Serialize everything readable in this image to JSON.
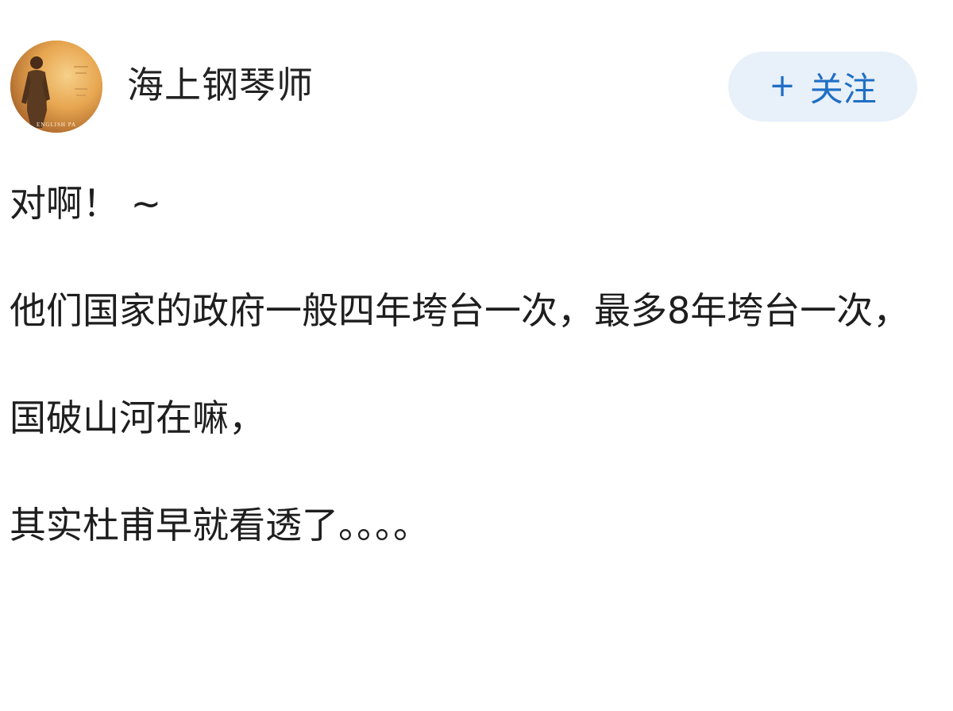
{
  "post": {
    "author": {
      "name": "海上钢琴师",
      "avatar_caption": "ENGLISH PA"
    },
    "follow_button": {
      "icon": "plus-icon",
      "plus_text": "+",
      "label": "关注"
    },
    "paragraphs": [
      "对啊！ ~",
      "他们国家的政府一般四年垮台一次，最多8年垮台一次，",
      "国破山河在嘛，",
      "其实杜甫早就看透了。。。。"
    ]
  },
  "colors": {
    "follow_bg": "#e8f0fa",
    "follow_text": "#1f6fc4",
    "body_text": "#1e1e1e",
    "avatar_warm": "#e5a24d"
  }
}
